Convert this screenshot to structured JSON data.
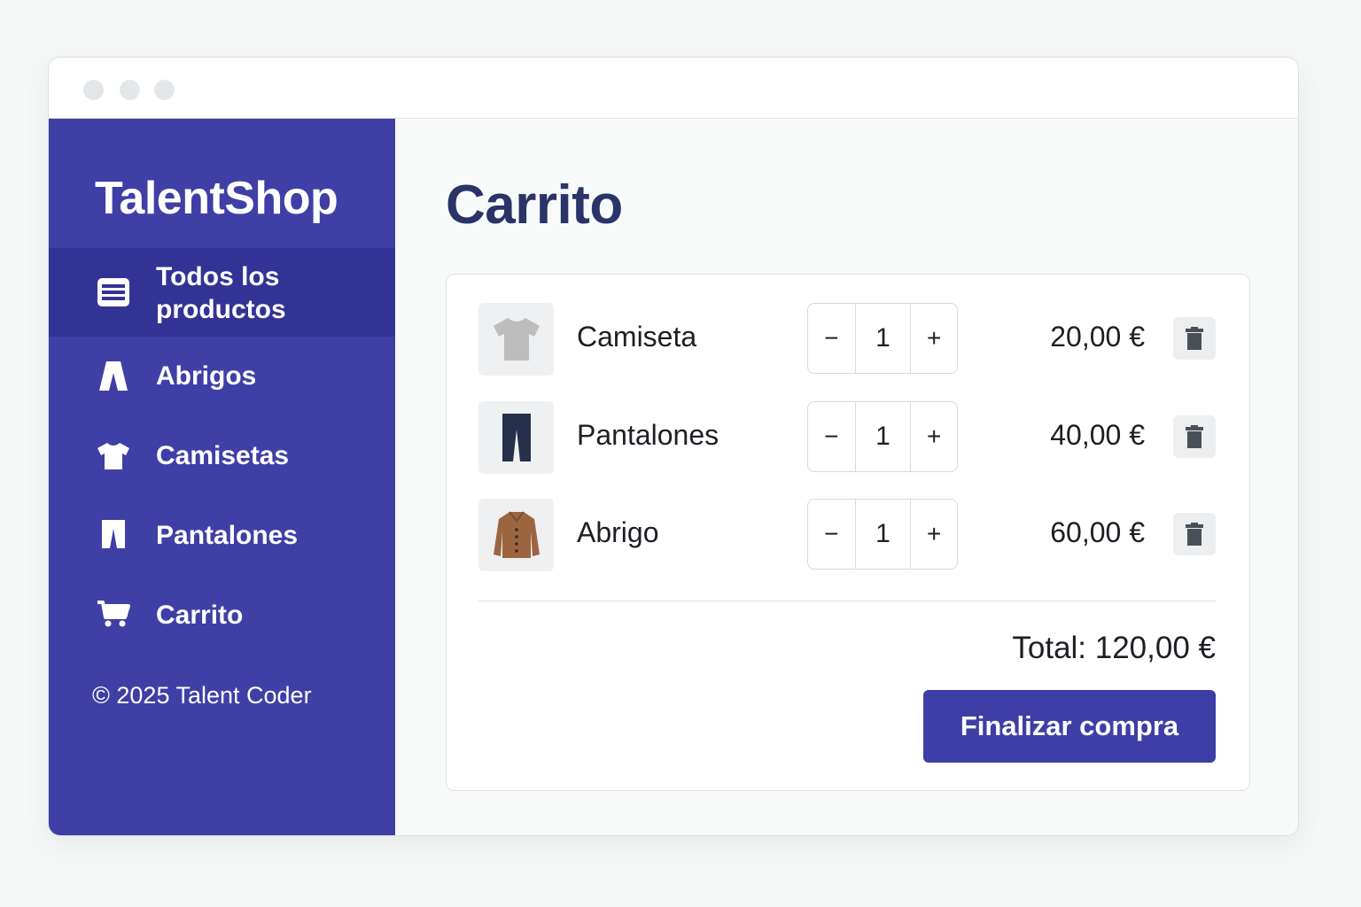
{
  "app": {
    "brand": "TalentShop",
    "footer": "© 2025 Talent Coder"
  },
  "sidebar": {
    "items": [
      {
        "label_line1": "Todos los",
        "label_line2": "productos",
        "icon": "list-icon",
        "active": true
      },
      {
        "label": "Abrigos",
        "icon": "coat-icon",
        "active": false
      },
      {
        "label": "Camisetas",
        "icon": "tshirt-icon",
        "active": false
      },
      {
        "label": "Pantalones",
        "icon": "pants-icon",
        "active": false
      },
      {
        "label": "Carrito",
        "icon": "cart-icon",
        "active": false
      }
    ]
  },
  "main": {
    "title": "Carrito",
    "cart": {
      "items": [
        {
          "name": "Camiseta",
          "quantity": "1",
          "price": "20,00 €",
          "image": "tshirt-image"
        },
        {
          "name": "Pantalones",
          "quantity": "1",
          "price": "40,00 €",
          "image": "pants-image"
        },
        {
          "name": "Abrigo",
          "quantity": "1",
          "price": "60,00 €",
          "image": "coat-image"
        }
      ],
      "decrement_label": "−",
      "increment_label": "+",
      "total": "Total: 120,00 €",
      "checkout_label": "Finalizar compra"
    }
  },
  "colors": {
    "sidebar": "#3f3fa6",
    "sidebar_active": "#333395",
    "title": "#2b3468",
    "button": "#3e3ea6"
  }
}
